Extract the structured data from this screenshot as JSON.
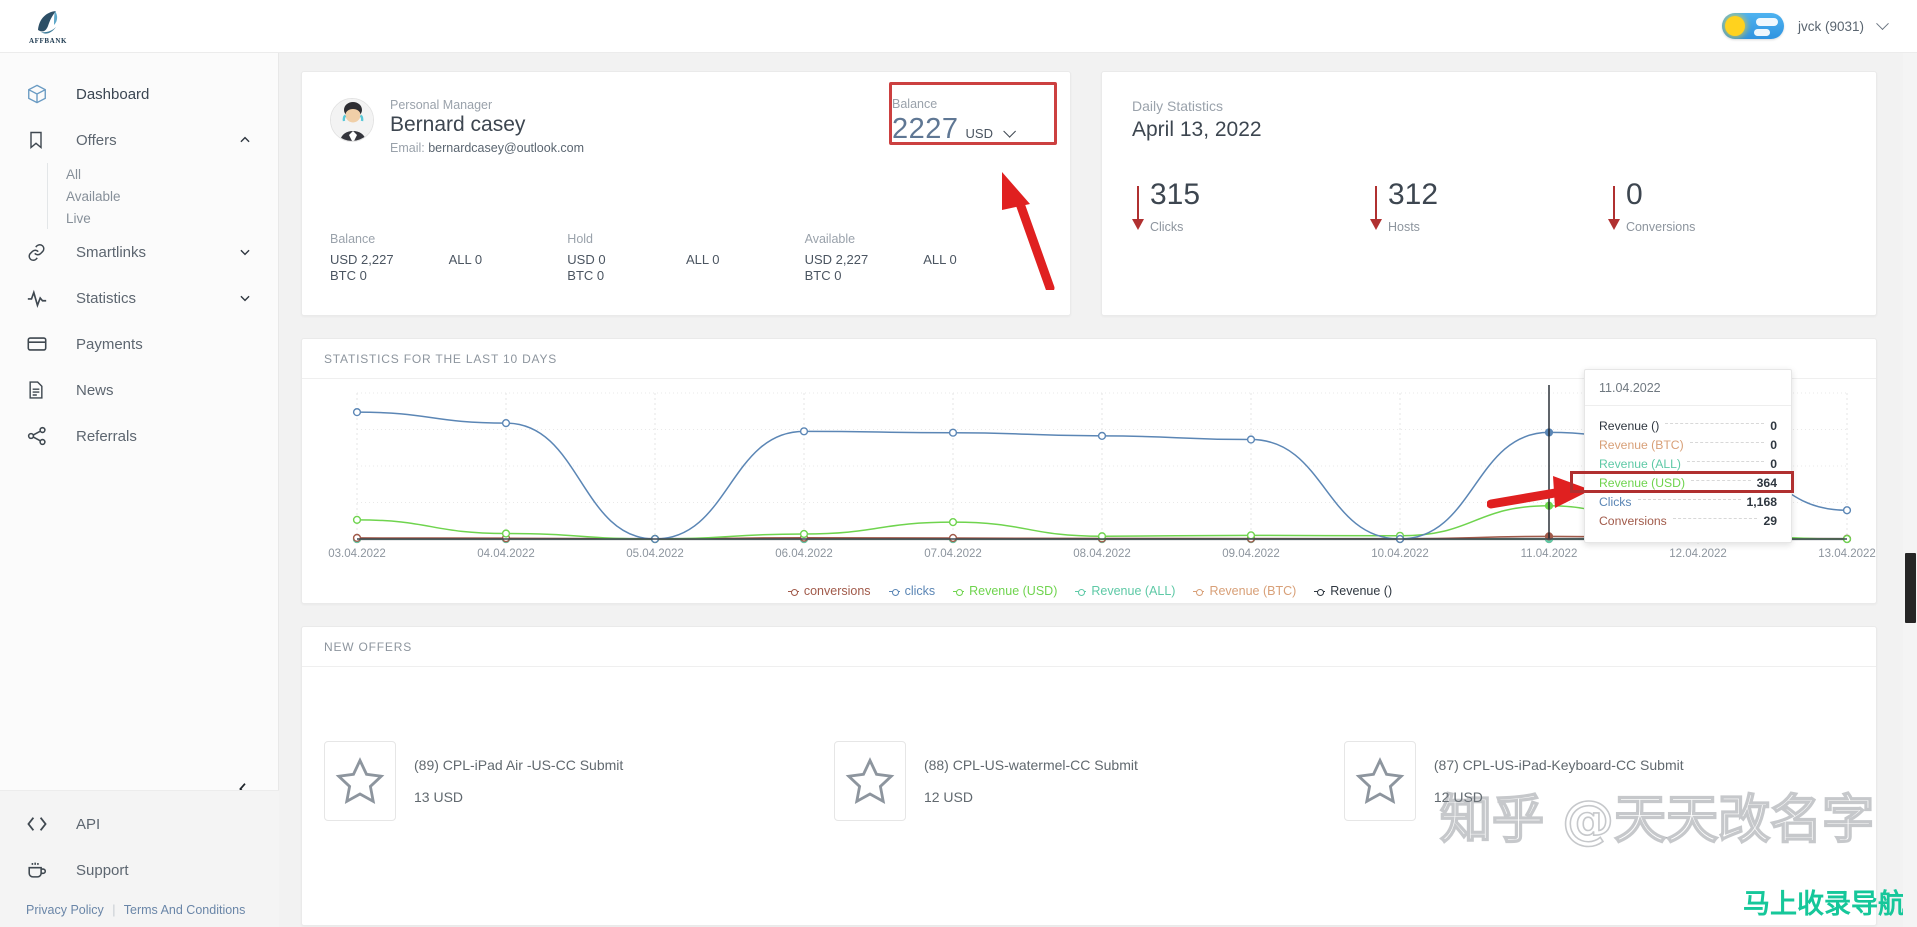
{
  "topbar": {
    "logo_text": "AFFBANK",
    "logo_icon": "affbank-logo-icon",
    "theme_toggle_icon": "day-night-toggle-icon",
    "user_label": "jvck (9031)",
    "user_chevron_icon": "chevron-down-icon"
  },
  "sidebar": {
    "items": [
      {
        "label": "Dashboard",
        "icon": "cube-icon",
        "expandable": false
      },
      {
        "label": "Offers",
        "icon": "bookmark-icon",
        "expandable": true,
        "caret": "chevron-up-icon"
      },
      {
        "label": "Smartlinks",
        "icon": "link-icon",
        "expandable": true,
        "caret": "chevron-down-icon"
      },
      {
        "label": "Statistics",
        "icon": "pulse-icon",
        "expandable": true,
        "caret": "chevron-down-icon"
      },
      {
        "label": "Payments",
        "icon": "credit-card-icon",
        "expandable": false
      },
      {
        "label": "News",
        "icon": "document-icon",
        "expandable": false
      },
      {
        "label": "Referrals",
        "icon": "share-icon",
        "expandable": false
      }
    ],
    "offers_sub": [
      {
        "label": "All"
      },
      {
        "label": "Available"
      },
      {
        "label": "Live"
      }
    ],
    "collapse_icon": "chevron-left-icon",
    "footer_items": [
      {
        "label": "API",
        "icon": "code-icon"
      },
      {
        "label": "Support",
        "icon": "coffee-cup-icon"
      }
    ],
    "legal": {
      "privacy": "Privacy Policy",
      "separator": "|",
      "terms": "Terms And Conditions"
    }
  },
  "manager_card": {
    "role_label": "Personal Manager",
    "name": "Bernard casey",
    "email_label": "Email:",
    "email": "bernardcasey@outlook.com",
    "avatar_icon": "user-avatar-icon",
    "balance_widget": {
      "label": "Balance",
      "amount": "2227",
      "currency": "USD",
      "chevron_icon": "chevron-down-icon",
      "highlight_color": "#cc4040"
    },
    "balance_groups": [
      {
        "title": "Balance",
        "primary": [
          "USD 2,227",
          "BTC 0"
        ],
        "secondary": [
          "ALL 0",
          ""
        ]
      },
      {
        "title": "Hold",
        "primary": [
          "USD 0",
          "BTC 0"
        ],
        "secondary": [
          "ALL 0",
          ""
        ]
      },
      {
        "title": "Available",
        "primary": [
          "USD 2,227",
          "BTC 0"
        ],
        "secondary": [
          "ALL 0",
          ""
        ]
      }
    ]
  },
  "daily_statistics": {
    "label": "Daily Statistics",
    "date": "April 13, 2022",
    "metrics": [
      {
        "value": "315",
        "caption": "Clicks",
        "arrow_icon": "arrow-down-icon"
      },
      {
        "value": "312",
        "caption": "Hosts",
        "arrow_icon": "arrow-down-icon"
      },
      {
        "value": "0",
        "caption": "Conversions",
        "arrow_icon": "arrow-down-icon"
      }
    ],
    "arrow_color": "#b03030"
  },
  "statistics_chart": {
    "title": "STATISTICS FOR THE LAST 10 DAYS",
    "tooltip": {
      "date": "11.04.2022",
      "highlight_color": "#b03030",
      "highlighted_row": "Revenue (USD)",
      "rows": [
        {
          "name": "Revenue ()",
          "value": "0",
          "color": "#2f3740"
        },
        {
          "name": "Revenue (BTC)",
          "value": "0",
          "color": "#d8a078"
        },
        {
          "name": "Revenue (ALL)",
          "value": "0",
          "color": "#5ec9a6"
        },
        {
          "name": "Revenue (USD)",
          "value": "364",
          "color": "#6fd44e"
        },
        {
          "name": "Clicks",
          "value": "1,168",
          "color": "#5b86b5"
        },
        {
          "name": "Conversions",
          "value": "29",
          "color": "#a15a4a"
        }
      ]
    }
  },
  "chart_data": {
    "type": "line",
    "title": "STATISTICS FOR THE LAST 10 DAYS",
    "xlabel": "",
    "ylabel": "",
    "grid": true,
    "legend_position": "bottom",
    "x": [
      "03.04.2022",
      "04.04.2022",
      "05.04.2022",
      "06.04.2022",
      "07.04.2022",
      "08.04.2022",
      "09.04.2022",
      "10.04.2022",
      "11.04.2022",
      "12.04.2022",
      "13.04.2022"
    ],
    "ylim": [
      0,
      1600
    ],
    "series": [
      {
        "name": "conversions",
        "color": "#a15a4a",
        "values": [
          12,
          9,
          0,
          14,
          11,
          6,
          4,
          2,
          29,
          8,
          3
        ]
      },
      {
        "name": "clicks",
        "color": "#5b86b5",
        "values": [
          1390,
          1270,
          0,
          1180,
          1165,
          1130,
          1090,
          0,
          1168,
          980,
          315
        ]
      },
      {
        "name": "Revenue (USD)",
        "color": "#6fd44e",
        "values": [
          210,
          60,
          0,
          55,
          185,
          30,
          40,
          35,
          364,
          45,
          0
        ]
      },
      {
        "name": "Revenue (ALL)",
        "color": "#5ec9a6",
        "values": [
          0,
          0,
          0,
          0,
          0,
          0,
          0,
          0,
          0,
          0,
          0
        ]
      },
      {
        "name": "Revenue (BTC)",
        "color": "#d8a078",
        "values": [
          0,
          0,
          0,
          0,
          0,
          0,
          0,
          0,
          0,
          0,
          0
        ]
      },
      {
        "name": "Revenue ()",
        "color": "#2f3740",
        "values": [
          0,
          0,
          0,
          0,
          0,
          0,
          0,
          0,
          0,
          0,
          0
        ]
      }
    ]
  },
  "new_offers": {
    "title": "NEW OFFERS",
    "items": [
      {
        "name": "(89) CPL-iPad Air -US-CC Submit",
        "price": "13 USD",
        "icon": "star-icon"
      },
      {
        "name": "(88) CPL-US-watermel-CC Submit",
        "price": "12 USD",
        "icon": "star-icon"
      },
      {
        "name": "(87) CPL-US-iPad-Keyboard-CC Submit",
        "price": "12 USD",
        "icon": "star-icon"
      }
    ]
  },
  "watermarks": {
    "zhihu": "知乎 @天天改名字",
    "bottom": "马上收录导航"
  }
}
